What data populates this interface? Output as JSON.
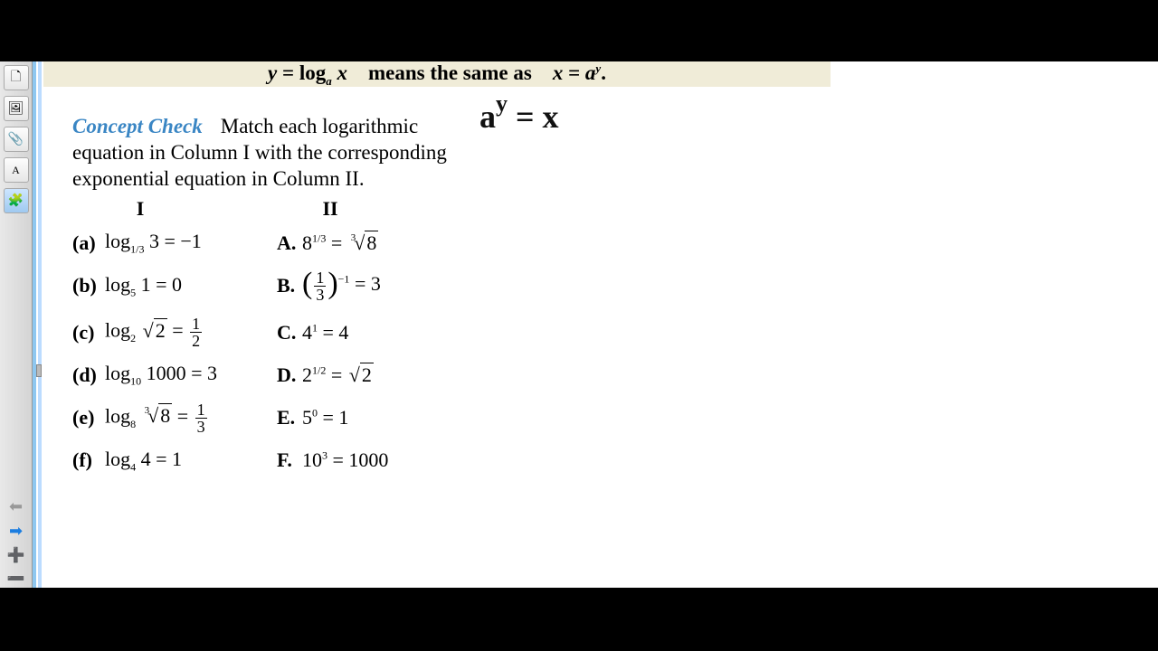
{
  "header": {
    "eq_lhs_var": "y",
    "eq_lhs_func": "log",
    "eq_lhs_base": "a",
    "eq_lhs_arg": "x",
    "means_text": "means the same as",
    "eq_rhs_var": "x",
    "eq_rhs_base": "a",
    "eq_rhs_exp": "y",
    "period": "."
  },
  "concept": {
    "title": "Concept Check",
    "text": "Match each logarithmic equation in Column I with the corresponding exponential equation in Column II."
  },
  "annotation": {
    "base": "a",
    "exp": "y",
    "eq": "=",
    "rhs": "x"
  },
  "columns": {
    "h1": "I",
    "h2": "II"
  },
  "rows": [
    {
      "ll": "(a)",
      "left_html": "log<span class='sub'>1/3</span> 3 = −1",
      "rl": "A.",
      "right_html": "8<span class='sup'>1/3</span> = <span class='root-index'>3</span><span class='sqrt'><span class='radicand'>8</span></span>"
    },
    {
      "ll": "(b)",
      "left_html": "log<span class='sub'>5</span> 1 = 0",
      "rl": "B.",
      "right_html": "<span class='bigparen'>(</span><span class='frac'><span class='num'>1</span><span class='den'>3</span></span><span class='bigparen'>)</span><span class='sup'>−1</span> = 3"
    },
    {
      "ll": "(c)",
      "left_html": "log<span class='sub'>2</span> <span class='sqrt'><span class='radicand'>2</span></span> = <span class='frac'><span class='num'>1</span><span class='den'>2</span></span>",
      "rl": "C.",
      "right_html": "4<span class='sup'>1</span> = 4"
    },
    {
      "ll": "(d)",
      "left_html": "log<span class='sub'>10</span> 1000 = 3",
      "rl": "D.",
      "right_html": "2<span class='sup'>1/2</span> = <span class='sqrt'><span class='radicand'>2</span></span>"
    },
    {
      "ll": "(e)",
      "left_html": "log<span class='sub'>8</span> <span class='root-index'>3</span><span class='sqrt'><span class='radicand'>8</span></span> = <span class='frac'><span class='num'>1</span><span class='den'>3</span></span>",
      "rl": "E.",
      "right_html": "5<span class='sup'>0</span> = 1"
    },
    {
      "ll": "(f)",
      "left_html": "log<span class='sub'>4</span> 4 = 1",
      "rl": "F.",
      "right_html": "10<span class='sup'>3</span> = 1000"
    }
  ],
  "toolbar": {
    "new": "🗋",
    "image": "🖼",
    "attach": "📎",
    "text": "A",
    "puzzle": "🧩",
    "hv": "↔",
    "prev": "⬅",
    "next": "➡",
    "add": "➕",
    "remove": "➖"
  }
}
